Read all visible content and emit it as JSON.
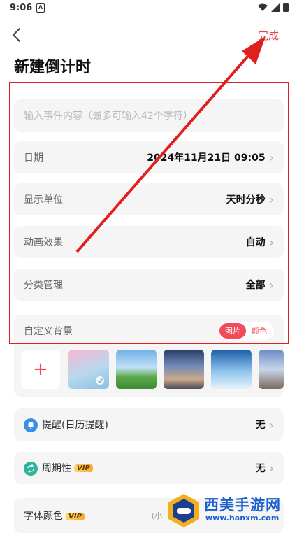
{
  "status": {
    "time": "9:06",
    "notif_letter": "A"
  },
  "nav": {
    "done_label": "完成"
  },
  "page": {
    "title": "新建倒计时"
  },
  "form": {
    "event_placeholder": "输入事件内容（最多可输入42个字符）",
    "date_label": "日期",
    "date_value": "2024年11月21日 09:05",
    "unit_label": "显示单位",
    "unit_value": "天时分秒",
    "anim_label": "动画效果",
    "anim_value": "自动",
    "category_label": "分类管理",
    "category_value": "全部",
    "bg_label": "自定义背景",
    "bg_toggle_image": "图片",
    "bg_toggle_color": "颜色"
  },
  "options": {
    "reminder_label": "提醒(日历提醒)",
    "reminder_value": "无",
    "repeat_label": "周期性",
    "repeat_value": "无",
    "font_color_label": "字体颜色",
    "font_color_hint": "(小",
    "vip_tag": "VIP"
  },
  "watermark": {
    "name": "西美手游网",
    "url": "www.hanxm.com"
  },
  "colors": {
    "accent": "#f14b5a",
    "highlight": "#e02020",
    "card": "#f5f5f5"
  }
}
